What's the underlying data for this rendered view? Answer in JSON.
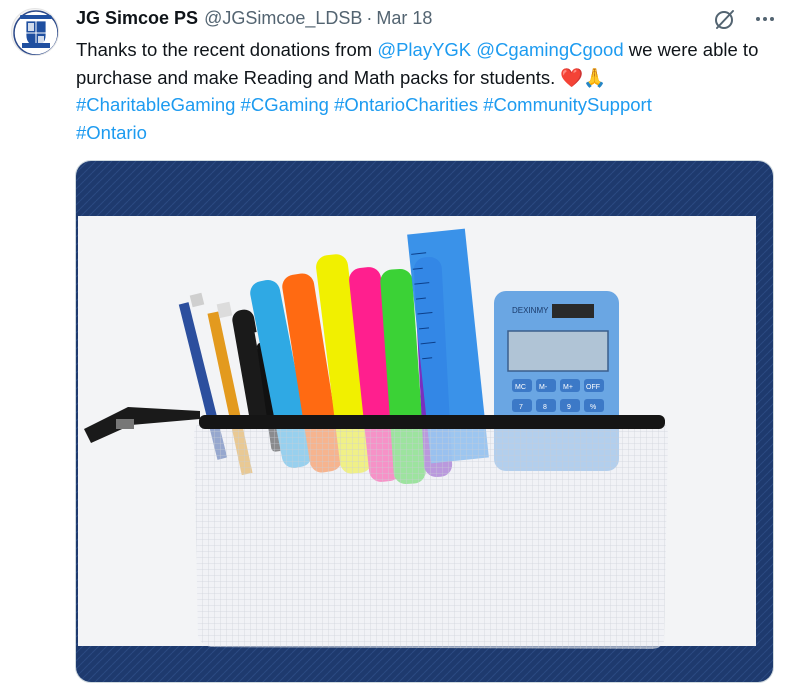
{
  "tweet": {
    "author_name": "JG Simcoe PS",
    "handle": "@JGSimcoe_LDSB",
    "separator": "·",
    "date": "Mar 18",
    "text": {
      "part1": "Thanks to the recent donations from ",
      "mention1": "@PlayYGK",
      "space1": " ",
      "mention2": "@CgamingCgood",
      "part2": " we were able to purchase and make Reading and Math packs for students. ",
      "emoji_heart": "❤️",
      "emoji_pray": "🙏",
      "hashtags": [
        "#CharitableGaming",
        "#CGaming",
        "#OntarioCharities",
        "#CommunitySupport",
        "#Ontario"
      ]
    },
    "avatar_icon": "school-crest-icon",
    "actions": {
      "grok_icon": "grok-slash-circle-icon",
      "more_icon": "more-dots-icon"
    },
    "photo": {
      "calculator_brand": "DEXINMY",
      "calculator_keys": [
        "MC",
        "M-",
        "M+",
        "OFF",
        "7",
        "8",
        "9",
        "%"
      ]
    }
  },
  "colors": {
    "link": "#1d9bf0",
    "text": "#0f1419",
    "muted": "#536471",
    "background_photo": "#1e3a6e"
  }
}
